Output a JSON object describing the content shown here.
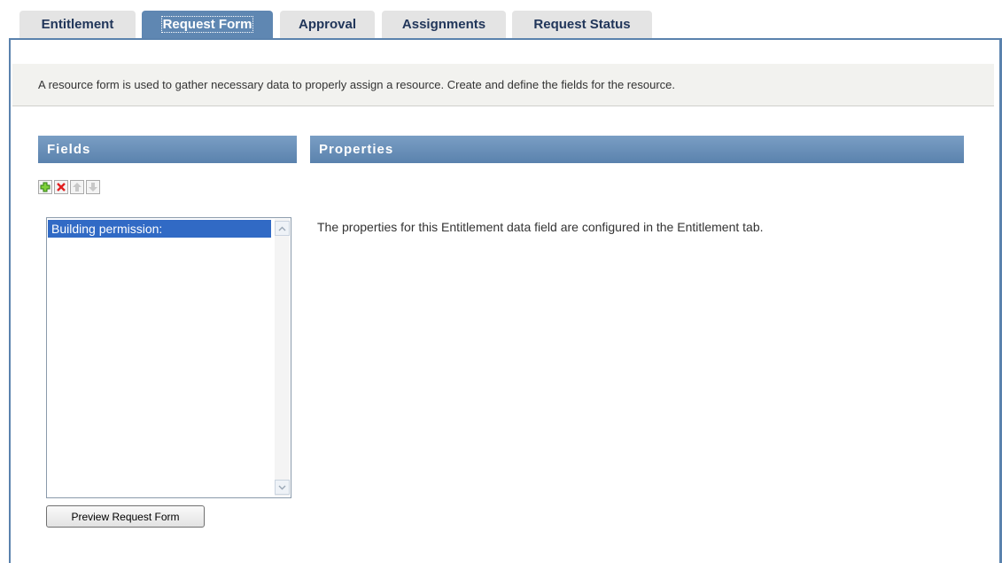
{
  "tabs": [
    {
      "label": "Entitlement",
      "active": false
    },
    {
      "label": "Request Form",
      "active": true
    },
    {
      "label": "Approval",
      "active": false
    },
    {
      "label": "Assignments",
      "active": false
    },
    {
      "label": "Request Status",
      "active": false
    }
  ],
  "info_text": "A resource form is used to gather necessary data to properly assign a resource. Create and define the fields for the resource.",
  "fields_panel": {
    "title": "Fields",
    "toolbar": {
      "add_icon": "add-icon",
      "delete_icon": "delete-icon",
      "move_up_icon": "arrow-up-icon",
      "move_down_icon": "arrow-down-icon"
    },
    "items": [
      "Building permission:"
    ],
    "preview_button": "Preview Request Form"
  },
  "properties_panel": {
    "title": "Properties",
    "message": "The properties for this Entitlement data field are configured in the Entitlement tab."
  },
  "colors": {
    "accent": "#5a82ad",
    "selection": "#316ac5"
  }
}
